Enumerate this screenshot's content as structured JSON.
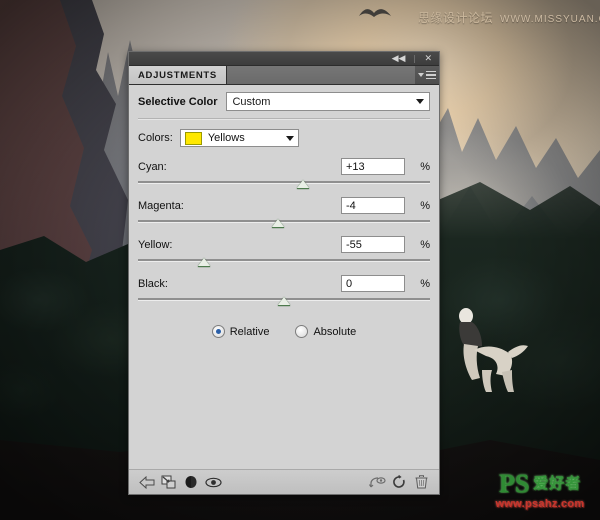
{
  "photo": {
    "watermark_top": {
      "cn": "思缘设计论坛",
      "url": "WWW.MISSYUAN.COM"
    },
    "logo": {
      "ps": "PS",
      "cn": "爱好者",
      "url": "www.psahz.com"
    }
  },
  "panel": {
    "titlebar": {
      "collapse": "◀◀",
      "close": "✕"
    },
    "tab_label": "ADJUSTMENTS",
    "preset": {
      "label": "Selective Color",
      "value": "Custom"
    },
    "colors": {
      "label": "Colors:",
      "value": "Yellows",
      "swatch_hex": "#ffe800"
    },
    "sliders": [
      {
        "name": "Cyan:",
        "value": "+13",
        "unit": "%",
        "pos_pct": 56.5
      },
      {
        "name": "Magenta:",
        "value": "-4",
        "unit": "%",
        "pos_pct": 48.0
      },
      {
        "name": "Yellow:",
        "value": "-55",
        "unit": "%",
        "pos_pct": 22.5
      },
      {
        "name": "Black:",
        "value": "0",
        "unit": "%",
        "pos_pct": 50.0
      }
    ],
    "method": {
      "relative": {
        "label": "Relative",
        "selected": true
      },
      "absolute": {
        "label": "Absolute",
        "selected": false
      }
    },
    "footer_icons": [
      "return-to-adjustment-list-icon",
      "clip-to-layer-icon",
      "toggle-layer-mask-icon",
      "toggle-layer-visibility-icon",
      "view-previous-state-icon",
      "reset-adjustment-icon",
      "delete-adjustment-icon"
    ]
  }
}
